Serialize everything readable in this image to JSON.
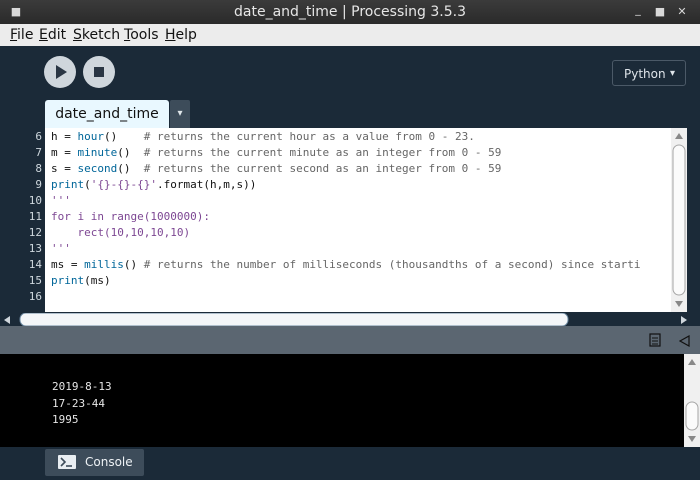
{
  "window": {
    "title": "date_and_time | Processing 3.5.3"
  },
  "menu": {
    "items": [
      "File",
      "Edit",
      "Sketch",
      "Tools",
      "Help"
    ],
    "mnemonics": [
      "F",
      "E",
      "S",
      "T",
      "H"
    ]
  },
  "toolbar": {
    "mode_label": "Python",
    "mode_arrow": "▾",
    "run_icon": "play-icon",
    "stop_icon": "stop-icon"
  },
  "tab": {
    "name": "date_and_time",
    "arrow": "▾"
  },
  "editor": {
    "line_numbers": [
      "6",
      "7",
      "8",
      "9",
      "10",
      "11",
      "12",
      "13",
      "14",
      "15",
      "16"
    ]
  },
  "console": {
    "lines": [
      "2019-8-13",
      "17-23-44",
      "1995"
    ],
    "tab_label": "Console"
  },
  "colors": {
    "background": "#1b2a38",
    "tab_active": "#e9f8ff",
    "keyword": "#33997e",
    "function": "#006699",
    "comment": "#666666",
    "string": "#7d4793"
  }
}
